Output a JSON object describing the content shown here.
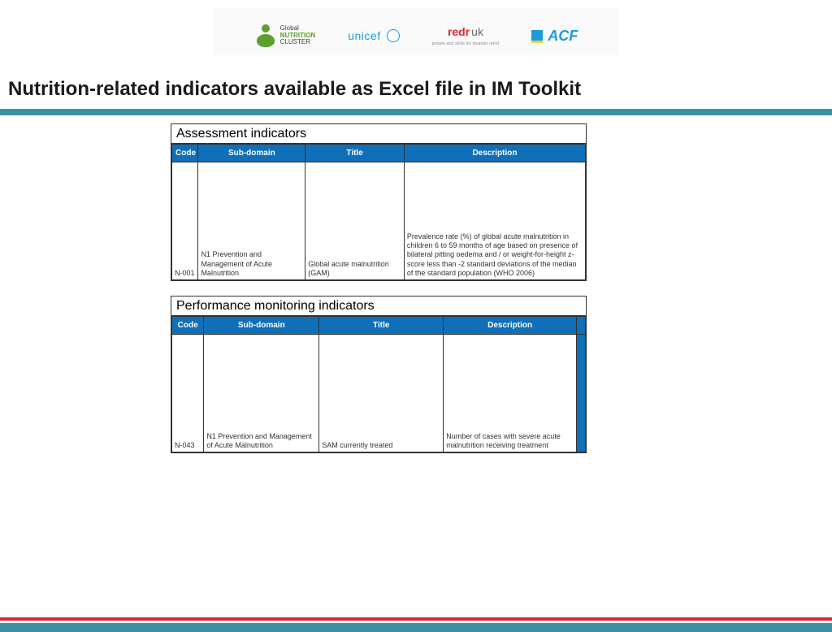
{
  "logos": {
    "gnc_line1": "Global",
    "gnc_line2": "NUTRITION",
    "gnc_line3": "CLUSTER",
    "unicef": "unicef",
    "redr_red": "redr",
    "redr_uk": "uk",
    "redr_sub": "people and skills for disaster relief",
    "acf": "ACF"
  },
  "title": "Nutrition-related indicators available as Excel file in IM Toolkit",
  "table1": {
    "heading": "Assessment indicators",
    "headers": {
      "code": "Code",
      "sub": "Sub-domain",
      "title": "Title",
      "desc": "Description"
    },
    "row": {
      "code": "N-001",
      "sub": "N1 Prevention and Management of Acute Malnutrition",
      "title": "Global acute malnutrition (GAM)",
      "desc": "Prevalence rate (%) of global acute malnutrition in children 6 to 59 months of age based on presence of bilateral pitting oedema and / or weight-for-height z-score less than -2 standard deviations of the median of the standard population (WHO 2006)"
    }
  },
  "table2": {
    "heading": "Performance monitoring indicators",
    "headers": {
      "code": "Code",
      "sub": "Sub-domain",
      "title": "Title",
      "desc": "Description"
    },
    "row": {
      "code": "N-043",
      "sub": "N1 Prevention and Management of Acute Malnutrition",
      "title": "SAM currently treated",
      "desc": "Number of cases with severe acute malnutrition receiving treatment"
    }
  }
}
